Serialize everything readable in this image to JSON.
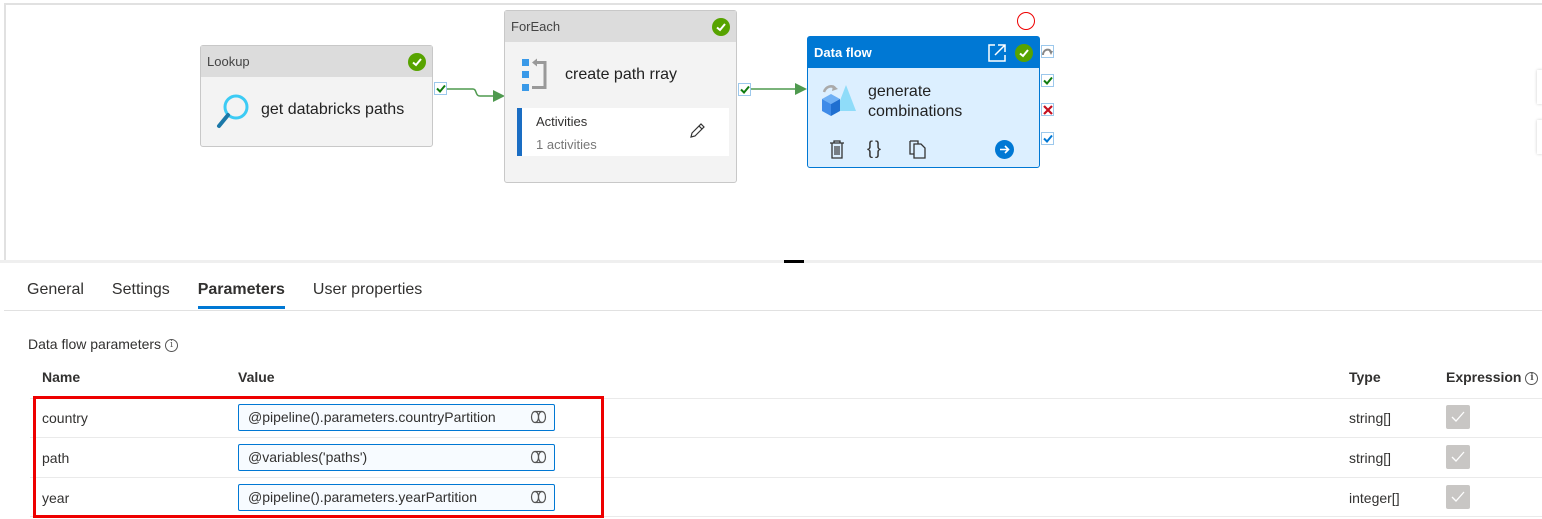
{
  "pipeline": {
    "activities": [
      {
        "type": "Lookup",
        "name": "get databricks paths",
        "status": "succeeded",
        "icon": "magnifier-icon"
      },
      {
        "type": "ForEach",
        "name": "create path rray",
        "status": "succeeded",
        "icon": "foreach-icon",
        "inner": {
          "label": "Activities",
          "count_text": "1 activities"
        }
      },
      {
        "type": "Data flow",
        "name_line1": "generate",
        "name_line2": "combinations",
        "status": "succeeded",
        "icon": "dataflow-icon",
        "selected": true
      }
    ]
  },
  "tabs": [
    {
      "label": "General",
      "active": false
    },
    {
      "label": "Settings",
      "active": false
    },
    {
      "label": "Parameters",
      "active": true
    },
    {
      "label": "User properties",
      "active": false
    }
  ],
  "section": {
    "title": "Data flow parameters"
  },
  "table": {
    "headers": {
      "name": "Name",
      "value": "Value",
      "type": "Type",
      "expression": "Expression"
    },
    "rows": [
      {
        "name": "country",
        "value": "@pipeline().parameters.countryPartition",
        "type": "string[]",
        "expression": true
      },
      {
        "name": "path",
        "value": "@variables('paths')",
        "type": "string[]",
        "expression": true
      },
      {
        "name": "year",
        "value": "@pipeline().parameters.yearPartition",
        "type": "integer[]",
        "expression": true
      }
    ]
  },
  "colors": {
    "accent": "#0078d4",
    "success": "#57a300",
    "highlight": "#ee0000"
  }
}
